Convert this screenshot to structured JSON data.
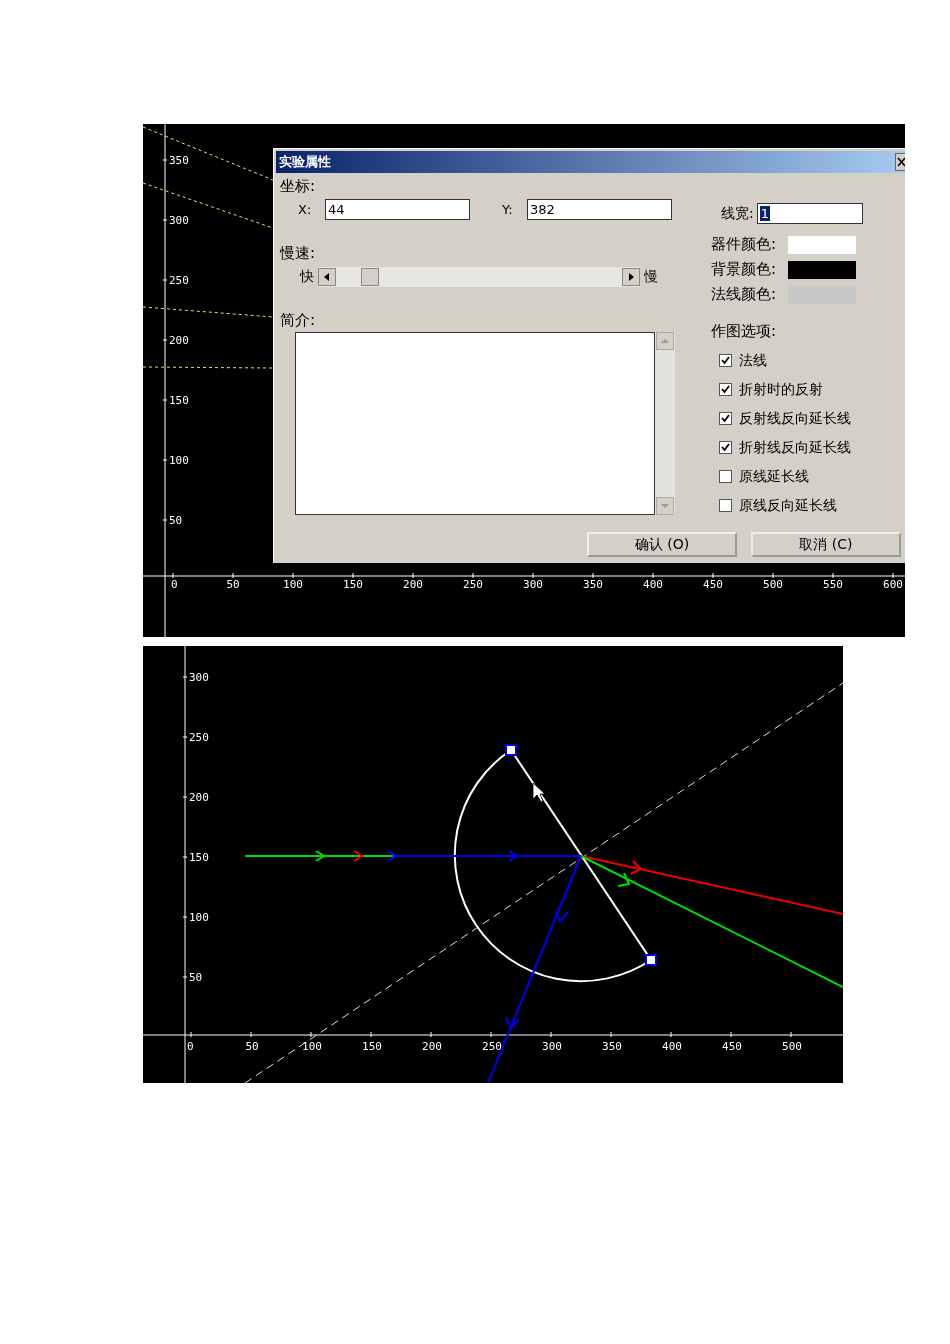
{
  "top_view": {
    "y_ticks": [
      "350",
      "300",
      "250",
      "200",
      "150",
      "100",
      "50"
    ],
    "x_ticks": [
      "0",
      "50",
      "100",
      "150",
      "200",
      "250",
      "300",
      "350",
      "400",
      "450",
      "500",
      "550",
      "600"
    ]
  },
  "dialog": {
    "title": "实验属性",
    "coords_label": "坐标:",
    "x_label": "X:",
    "x_value": "44",
    "y_label": "Y:",
    "y_value": "382",
    "line_width_label": "线宽:",
    "line_width_value": "1",
    "speed_label": "慢速:",
    "fast_label": "快",
    "slow_label": "慢",
    "speed_slider": {
      "level": 0.12
    },
    "intro_label": "简介:",
    "colors": [
      {
        "label": "器件颜色:",
        "color": "#ffffff"
      },
      {
        "label": "背景颜色:",
        "color": "#000000"
      },
      {
        "label": "法线颜色:",
        "color": "#c8c8c8"
      }
    ],
    "options_label": "作图选项:",
    "options": [
      {
        "label": "法线",
        "checked": true
      },
      {
        "label": "折射时的反射",
        "checked": true
      },
      {
        "label": "反射线反向延长线",
        "checked": true
      },
      {
        "label": "折射线反向延长线",
        "checked": true
      },
      {
        "label": "原线延长线",
        "checked": false
      },
      {
        "label": "原线反向延长线",
        "checked": false
      }
    ],
    "buttons": [
      "确认 (O)",
      "取消 (C)"
    ]
  },
  "bottom_view": {
    "y_ticks": [
      "300",
      "250",
      "200",
      "150",
      "100",
      "50"
    ],
    "x_ticks": [
      "0",
      "50",
      "100",
      "150",
      "200",
      "250",
      "300",
      "350",
      "400",
      "450",
      "500"
    ]
  }
}
